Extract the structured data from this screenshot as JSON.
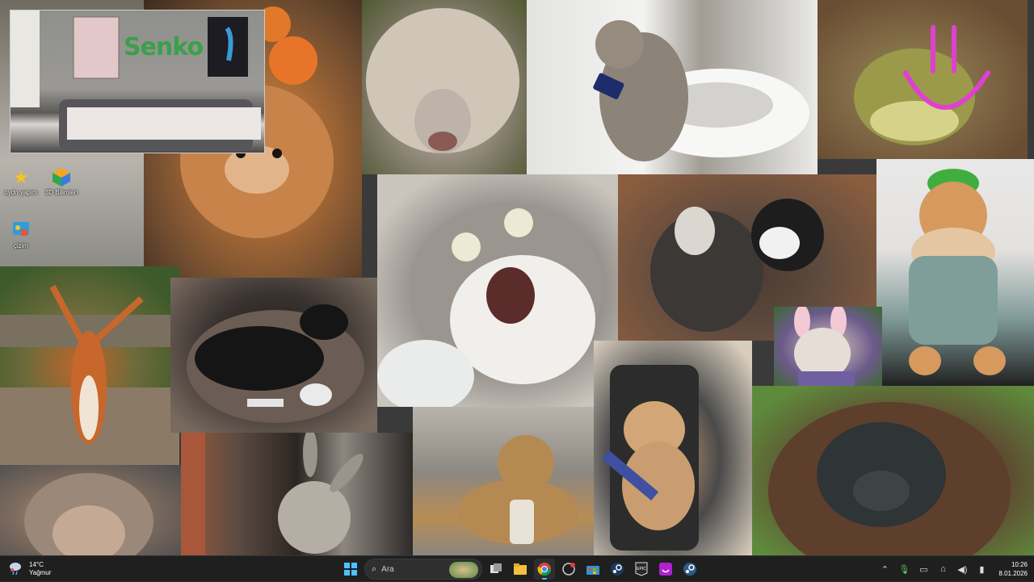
{
  "desktop": {
    "tiles": [
      {
        "id": "room",
        "name": "room-photo-tile"
      },
      {
        "id": "dog-orange",
        "name": "orange-dog-photo-tile"
      },
      {
        "id": "sheep",
        "name": "sheep-photo-tile"
      },
      {
        "id": "cat-toilet",
        "name": "cat-on-toilet-photo-tile"
      },
      {
        "id": "frog",
        "name": "frog-photo-tile"
      },
      {
        "id": "squirrel",
        "name": "squirrel-photo-tile"
      },
      {
        "id": "monkey",
        "name": "monkey-photo-tile"
      },
      {
        "id": "blackdog",
        "name": "black-dog-photo-tile"
      },
      {
        "id": "donkey",
        "name": "donkey-photo-tile"
      },
      {
        "id": "cat-scream",
        "name": "screaming-cat-photo-tile"
      },
      {
        "id": "dog-fight",
        "name": "dogs-photo-tile"
      },
      {
        "id": "cat-hat",
        "name": "cat-with-hat-photo-tile"
      },
      {
        "id": "bulldog",
        "name": "bulldog-photo-tile"
      },
      {
        "id": "dog-street",
        "name": "street-dog-photo-tile"
      },
      {
        "id": "cat-gamer",
        "name": "gamer-cat-photo-tile"
      },
      {
        "id": "orangutan",
        "name": "orangutan-photo-tile"
      }
    ],
    "room_wall_text": "Senko",
    "smiley_color": "#e040d0",
    "icons": [
      {
        "label": "oydn yapım",
        "icon": "star-icon"
      },
      {
        "label": "3D Bilimleri",
        "icon": "cube-icon"
      },
      {
        "label": "çizim",
        "icon": "paint-icon"
      }
    ]
  },
  "taskbar": {
    "weather": {
      "temp": "14°C",
      "condition": "Yağmur",
      "icon": "rain-cloud-icon"
    },
    "search_placeholder": "Ara",
    "apps": [
      {
        "name": "start-button",
        "icon": "windows-logo-icon"
      },
      {
        "name": "task-view-button",
        "icon": "task-view-icon"
      },
      {
        "name": "file-explorer-button",
        "icon": "folder-icon"
      },
      {
        "name": "chrome-button",
        "icon": "chrome-icon"
      },
      {
        "name": "app-notify-button",
        "icon": "app-icon"
      },
      {
        "name": "store-button",
        "icon": "store-icon"
      },
      {
        "name": "steam-button",
        "icon": "steam-icon"
      },
      {
        "name": "epic-games-button",
        "icon": "epic-games-icon"
      },
      {
        "name": "purple-app-button",
        "icon": "purple-app-icon"
      },
      {
        "name": "steam-alt-button",
        "icon": "steam-icon"
      }
    ],
    "tray": {
      "time": "10:26",
      "date": "8.01.2026"
    },
    "accent_color": "#4cc2ff"
  }
}
